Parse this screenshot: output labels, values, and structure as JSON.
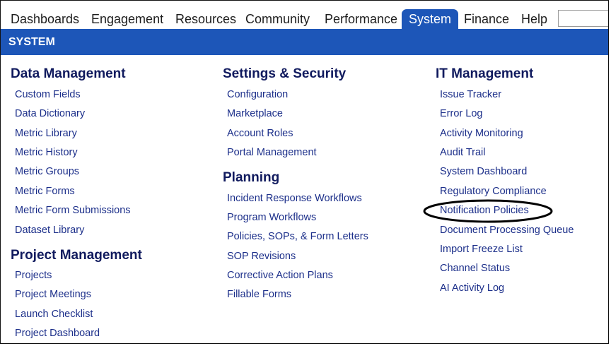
{
  "nav": {
    "tabs": [
      "Dashboards",
      "Engagement",
      "Resources",
      "Community",
      "Performance",
      "System",
      "Finance",
      "Help"
    ],
    "active_tab": "System"
  },
  "section_bar": {
    "title": "SYSTEM"
  },
  "columns": {
    "data_management": {
      "heading": "Data Management",
      "items": [
        "Custom Fields",
        "Data Dictionary",
        "Metric Library",
        "Metric History",
        "Metric Groups",
        "Metric Forms",
        "Metric Form Submissions",
        "Dataset Library"
      ]
    },
    "project_management": {
      "heading": "Project Management",
      "items": [
        "Projects",
        "Project Meetings",
        "Launch Checklist",
        "Project Dashboard"
      ]
    },
    "settings_security": {
      "heading": "Settings & Security",
      "items": [
        "Configuration",
        "Marketplace",
        "Account Roles",
        "Portal Management"
      ]
    },
    "planning": {
      "heading": "Planning",
      "items": [
        "Incident Response Workflows",
        "Program Workflows",
        "Policies, SOPs, & Form Letters",
        "SOP Revisions",
        "Corrective Action Plans",
        "Fillable Forms"
      ]
    },
    "it_management": {
      "heading": "IT Management",
      "items": [
        "Issue Tracker",
        "Error Log",
        "Activity Monitoring",
        "Audit Trail",
        "System Dashboard",
        "Regulatory Compliance",
        "Notification Policies",
        "Document Processing Queue",
        "Import Freeze List",
        "Channel Status",
        "AI Activity Log"
      ]
    }
  },
  "colors": {
    "accent": "#1d56b8",
    "heading": "#101a5e",
    "link": "#1c2f8a"
  }
}
